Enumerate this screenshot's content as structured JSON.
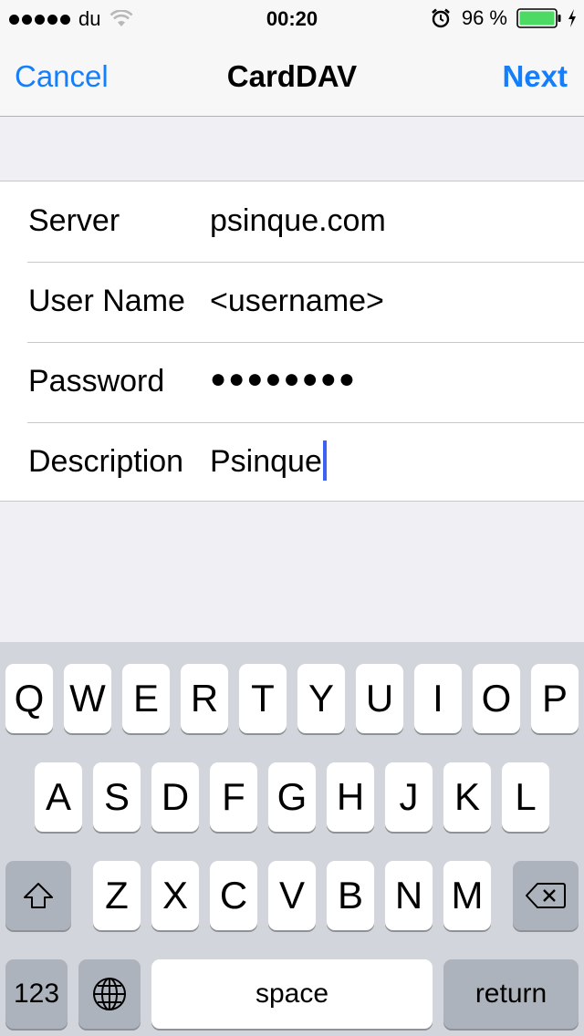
{
  "status_bar": {
    "carrier": "du",
    "time": "00:20",
    "battery_percent": "96 %",
    "signal_dots": 5,
    "icons": [
      "wifi-icon",
      "alarm-icon",
      "battery-icon",
      "charging-bolt-icon"
    ]
  },
  "nav": {
    "cancel_label": "Cancel",
    "title": "CardDAV",
    "next_label": "Next",
    "accent_color": "#157efb"
  },
  "form": {
    "rows": [
      {
        "label": "Server",
        "value": "psinque.com"
      },
      {
        "label": "User Name",
        "value": "<username>"
      },
      {
        "label": "Password",
        "value": "●●●●●●●●"
      },
      {
        "label": "Description",
        "value": "Psinque"
      }
    ]
  },
  "keyboard": {
    "row1": [
      "Q",
      "W",
      "E",
      "R",
      "T",
      "Y",
      "U",
      "I",
      "O",
      "P"
    ],
    "row2": [
      "A",
      "S",
      "D",
      "F",
      "G",
      "H",
      "J",
      "K",
      "L"
    ],
    "row3": [
      "Z",
      "X",
      "C",
      "V",
      "B",
      "N",
      "M"
    ],
    "numbers_label": "123",
    "space_label": "space",
    "return_label": "return",
    "icons": [
      "shift-icon",
      "delete-icon",
      "globe-icon"
    ]
  }
}
